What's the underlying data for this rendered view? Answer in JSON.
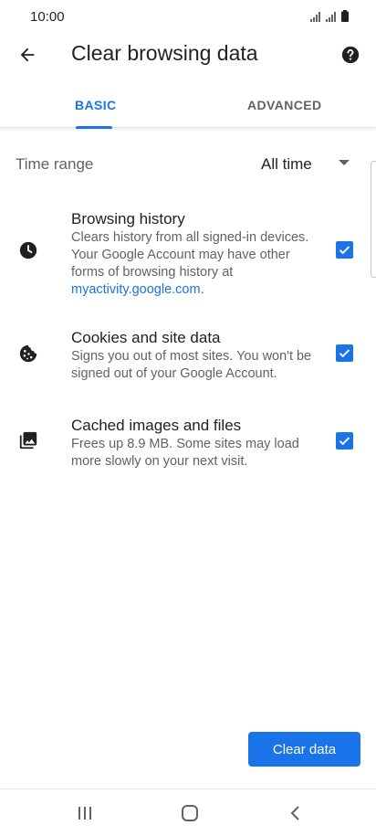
{
  "status_bar": {
    "time": "10:00"
  },
  "app_bar": {
    "title": "Clear browsing data"
  },
  "tabs": [
    {
      "label": "BASIC",
      "selected": true
    },
    {
      "label": "ADVANCED",
      "selected": false
    }
  ],
  "time_range": {
    "label": "Time range",
    "value": "All time"
  },
  "options": [
    {
      "title": "Browsing history",
      "description": "Clears history from all signed-in devices. Your Google Account may have other forms of browsing history at",
      "link": "myactivity.google.com",
      "link_suffix": ".",
      "checked": true,
      "icon": "clock-icon"
    },
    {
      "title": "Cookies and site data",
      "description": "Signs you out of most sites. You won't be signed out of your Google Account.",
      "checked": true,
      "icon": "cookie-icon"
    },
    {
      "title": "Cached images and files",
      "description": "Frees up 8.9 MB. Some sites may load more slowly on your next visit.",
      "checked": true,
      "icon": "image-icon"
    }
  ],
  "actions": {
    "clear_label": "Clear data"
  },
  "colors": {
    "accent": "#1a73e8",
    "text_primary": "#202124",
    "text_secondary": "#5f6368"
  }
}
